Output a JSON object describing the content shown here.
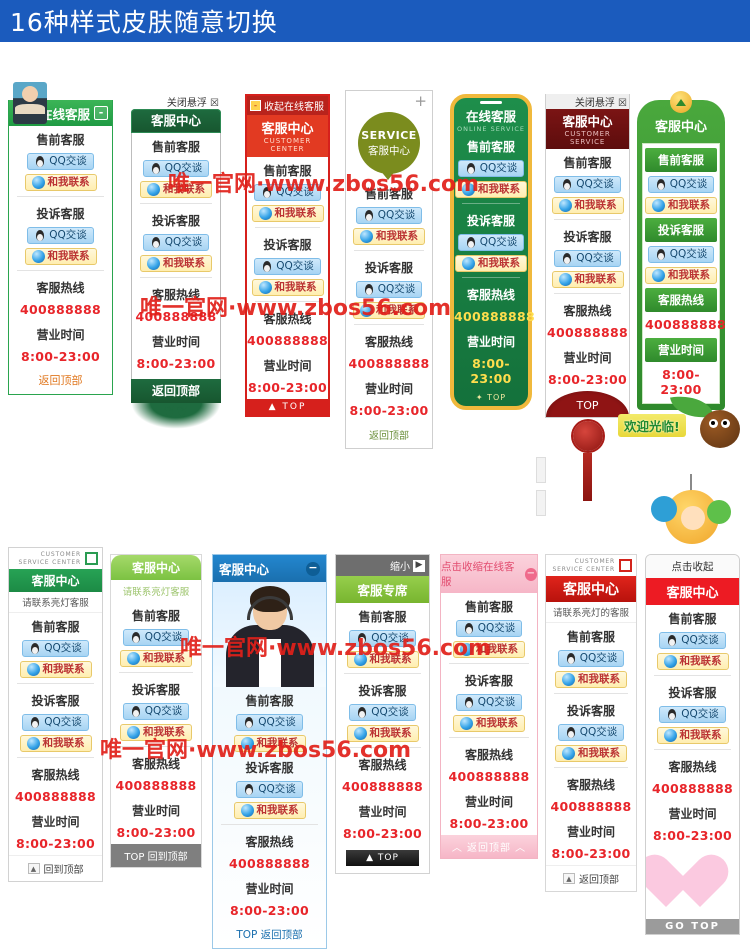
{
  "banner": {
    "title": "16种样式皮肤随意切换"
  },
  "common": {
    "presale": "售前客服",
    "complaint": "投诉客服",
    "hotline_label": "客服热线",
    "hotline_number": "400888888",
    "hours_label": "营业时间",
    "hours_value": "8:00-23:00",
    "qq_talk": "QQ交谈",
    "contact_me": "和我联系"
  },
  "watermarks": [
    "唯一官网·www.zbos56.com",
    "唯一官网·www.zbos56.com",
    "唯一官网·www.zbos56.com",
    "唯一官网·www.zbos56.com"
  ],
  "widgets": {
    "w1": {
      "title": "在线客服",
      "minimize": "-",
      "footer": "返回顶部"
    },
    "w2": {
      "close": "关闭悬浮",
      "close_icon": "☒",
      "title": "客服中心",
      "footer": "返回顶部"
    },
    "w3": {
      "collapse": "收起在线客服",
      "collapse_icon": "-",
      "title": "客服中心",
      "subtitle": "CUSTOMER CENTER",
      "footer": "▲ TOP"
    },
    "w4": {
      "expand": "+",
      "badge_en": "SERVICE",
      "badge_cn": "客服中心",
      "footer": "返回顶部"
    },
    "w5": {
      "title": "在线客服",
      "subtitle": "ONLINE SERVICE",
      "footer": "✦ TOP"
    },
    "w6": {
      "close": "关闭悬浮",
      "close_icon": "☒",
      "title": "客服中心",
      "subtitle": "CUSTOMER SERVICE",
      "footer": "TOP"
    },
    "w7": {
      "title": "客服中心"
    },
    "w8": {
      "en_line1": "CUSTOMER",
      "en_line2": "SERVICE CENTER",
      "title": "客服中心",
      "subtitle": "请联系亮灯客服",
      "footer": "回到顶部",
      "footer_icon": "▲"
    },
    "w9": {
      "title": "客服中心",
      "subtitle": "请联系亮灯客服",
      "footer": "TOP 回到顶部"
    },
    "w10": {
      "title": "客服中心",
      "minimize": "−",
      "footer": "TOP  返回顶部"
    },
    "w11": {
      "shrink": "缩小",
      "shrink_icon": "▶",
      "title": "客服专席",
      "footer": "▲ TOP"
    },
    "w12": {
      "collapse": "点击收缩在线客服",
      "collapse_icon": "−",
      "footer": "︿ 返回顶部 ︿"
    },
    "w13": {
      "en_line1": "CUSTOMER",
      "en_line2": "SERVICE CENTER",
      "title": "客服中心",
      "subtitle": "请联系亮灯的客服",
      "footer": "返回顶部",
      "footer_icon": "▲"
    },
    "w14": {
      "collapse": "点击收起",
      "title": "客服中心",
      "footer": "GO  TOP"
    }
  },
  "decor": {
    "welcome": "欢迎光临!"
  },
  "colors": {
    "banner_blue": "#1b5bbd",
    "green": "#2aa44e",
    "red": "#e0241c",
    "pink": "#f6b6c7",
    "hotline_red": "#e8252a",
    "watermark_red": "#e1201a"
  }
}
